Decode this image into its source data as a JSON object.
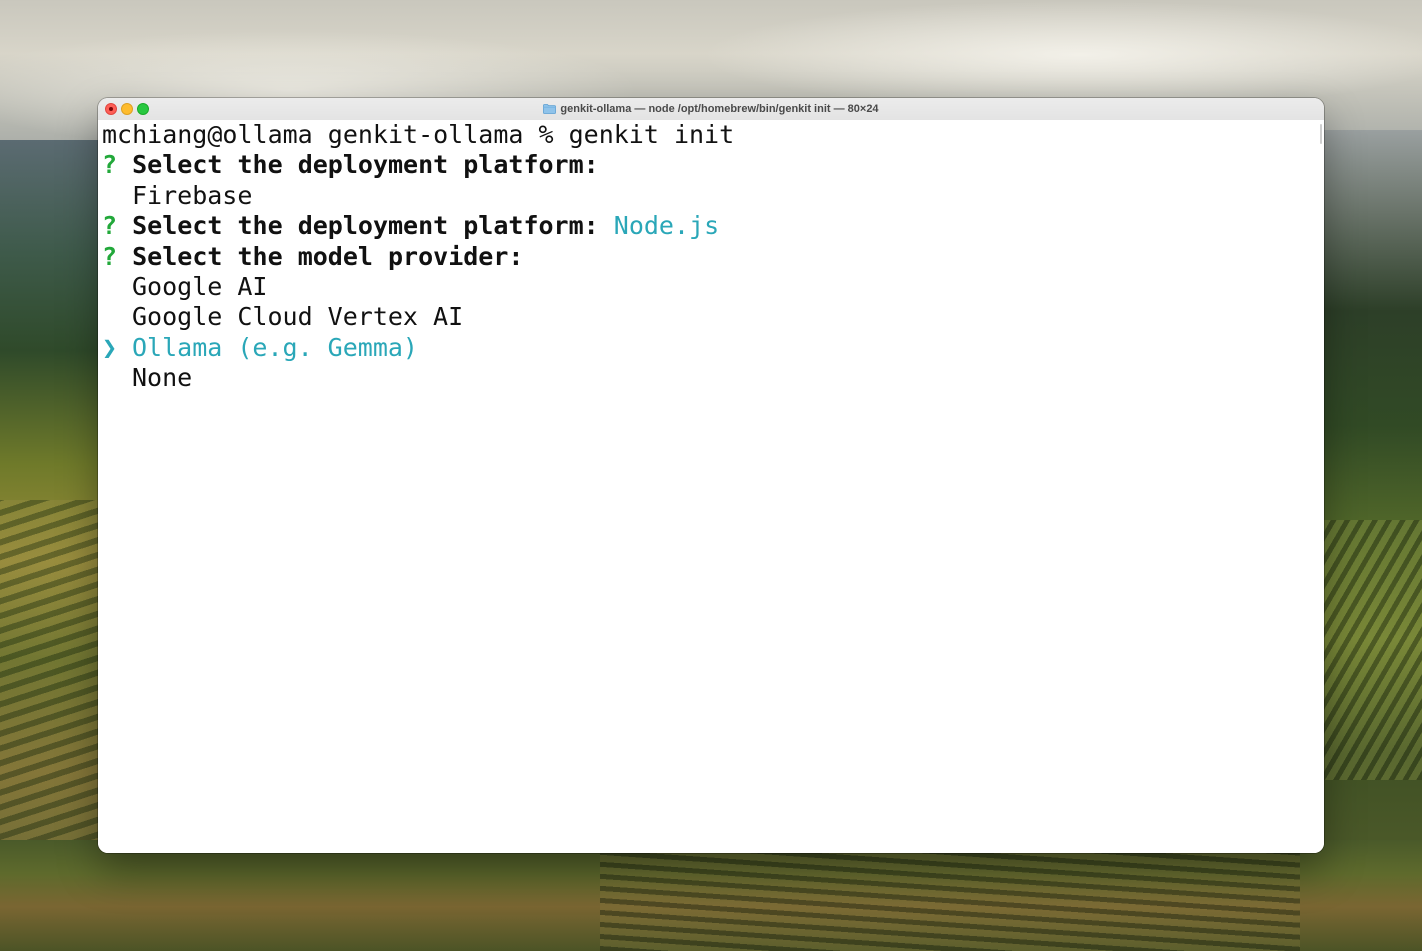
{
  "window": {
    "title": "genkit-ollama — node /opt/homebrew/bin/genkit init — 80×24",
    "title_icon": "folder-icon"
  },
  "terminal": {
    "command_line": "mchiang@ollama genkit-ollama % genkit init",
    "q1": {
      "marker": "?",
      "text": "Select the deployment platform:"
    },
    "q1_option": "Firebase",
    "q2": {
      "marker": "?",
      "text": "Select the deployment platform:",
      "answer": "Node.js"
    },
    "q3": {
      "marker": "?",
      "text": "Select the model provider:"
    },
    "options": [
      {
        "label": "Google AI",
        "selected": false
      },
      {
        "label": "Google Cloud Vertex AI",
        "selected": false
      },
      {
        "label": "Ollama (e.g. Gemma)",
        "selected": true,
        "pointer": "❯"
      },
      {
        "label": "None",
        "selected": false
      }
    ]
  },
  "colors": {
    "prompt_marker": "#22a83a",
    "accent": "#2aa7b8",
    "close": "#fe5f57",
    "minimize": "#febc2e",
    "maximize": "#28c840"
  }
}
